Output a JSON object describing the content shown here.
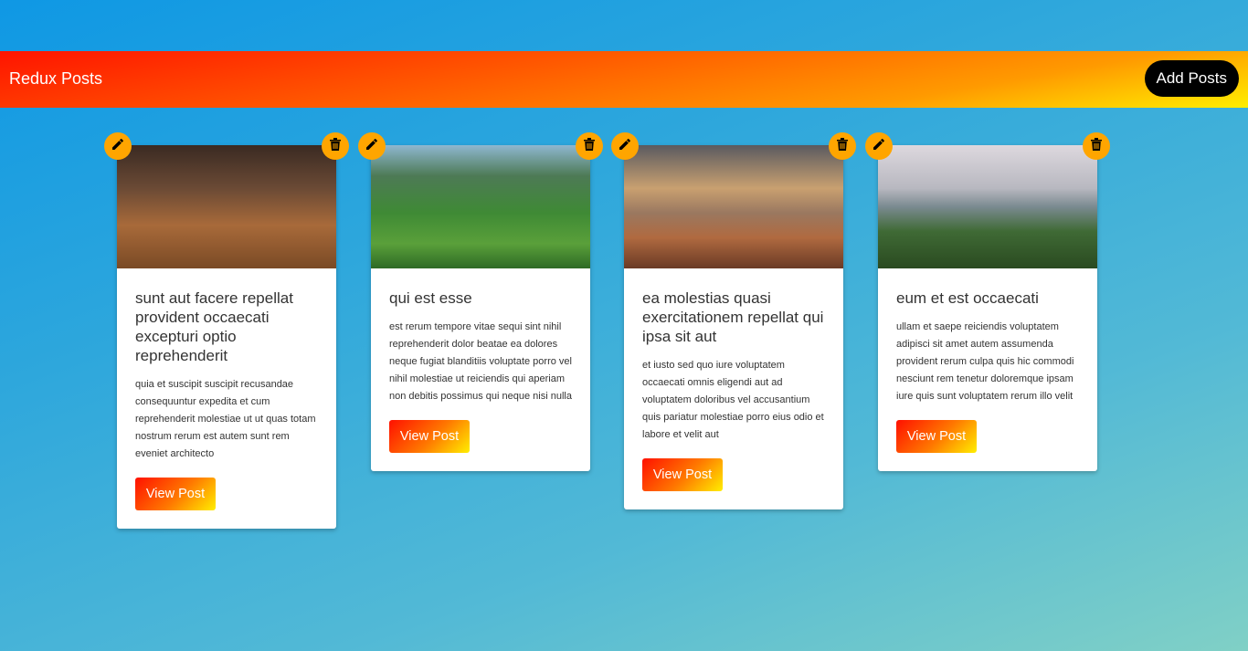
{
  "header": {
    "title": "Redux Posts",
    "add_label": "Add Posts"
  },
  "posts": [
    {
      "title": "sunt aut facere repellat provident occaecati excepturi optio reprehenderit",
      "body": "quia et suscipit suscipit recusandae consequuntur expedita et cum reprehenderit molestiae ut ut quas totam nostrum rerum est autem sunt rem eveniet architecto",
      "button": "View Post"
    },
    {
      "title": "qui est esse",
      "body": "est rerum tempore vitae sequi sint nihil reprehenderit dolor beatae ea dolores neque fugiat blanditiis voluptate porro vel nihil molestiae ut reiciendis qui aperiam non debitis possimus qui neque nisi nulla",
      "button": "View Post"
    },
    {
      "title": "ea molestias quasi exercitationem repellat qui ipsa sit aut",
      "body": "et iusto sed quo iure voluptatem occaecati omnis eligendi aut ad voluptatem doloribus vel accusantium quis pariatur molestiae porro eius odio et labore et velit aut",
      "button": "View Post"
    },
    {
      "title": "eum et est occaecati",
      "body": "ullam et saepe reiciendis voluptatem adipisci sit amet autem assumenda provident rerum culpa quis hic commodi nesciunt rem tenetur doloremque ipsam iure quis sunt voluptatem rerum illo velit",
      "button": "View Post"
    }
  ]
}
